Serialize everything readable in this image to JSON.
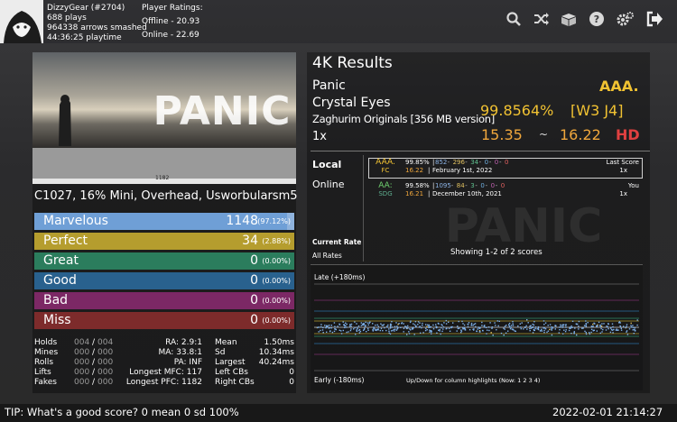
{
  "player": {
    "name": "DizzyGear (#2704)",
    "plays": "688 plays",
    "arrows": "964338 arrows smashed",
    "playtime": "44:36:25 playtime",
    "ratings_title": "Player Ratings:",
    "offline": "Offline - 20.93",
    "online": "Online - 22.69"
  },
  "toolbar": {
    "icons": [
      "search-icon",
      "shuffle-icon",
      "boxes-icon",
      "help-icon",
      "settings-icon",
      "exit-icon"
    ]
  },
  "song": {
    "banner_text": "PANIC",
    "graph_label": "1182",
    "modifiers": "C1027, 16% Mini, Overhead, Usworbularsm5"
  },
  "judgements": [
    {
      "label": "Marvelous",
      "count": "1148",
      "pct": "(97.12%)",
      "color": "#6f9fd6",
      "fill": 0.9712
    },
    {
      "label": "Perfect",
      "count": "34",
      "pct": "(2.88%)",
      "color": "#b59d2e",
      "fill": 0.0288
    },
    {
      "label": "Great",
      "count": "0",
      "pct": "(0.00%)",
      "color": "#2f8f6a",
      "fill": 0
    },
    {
      "label": "Good",
      "count": "0",
      "pct": "(0.00%)",
      "color": "#2d6fa3",
      "fill": 0
    },
    {
      "label": "Bad",
      "count": "0",
      "pct": "(0.00%)",
      "color": "#8e2c73",
      "fill": 0
    },
    {
      "label": "Miss",
      "count": "0",
      "pct": "(0.00%)",
      "color": "#8f2f2f",
      "fill": 0
    }
  ],
  "stats": {
    "col1": [
      {
        "label": "Holds",
        "v1": "004",
        "v2": "004"
      },
      {
        "label": "Mines",
        "v1": "000",
        "v2": "000"
      },
      {
        "label": "Rolls",
        "v1": "000",
        "v2": "000"
      },
      {
        "label": "Lifts",
        "v1": "000",
        "v2": "000"
      },
      {
        "label": "Fakes",
        "v1": "000",
        "v2": "000"
      }
    ],
    "col2": [
      "RA: 2.9:1",
      "MA: 33.8:1",
      "PA: INF",
      "Longest MFC: 117",
      "Longest PFC: 1182"
    ],
    "col3": [
      {
        "label": "Mean",
        "value": "1.50ms"
      },
      {
        "label": "Sd",
        "value": "10.34ms"
      },
      {
        "label": "Largest",
        "value": "40.24ms"
      },
      {
        "label": "Left CBs",
        "value": "0"
      },
      {
        "label": "Right CBs",
        "value": "0"
      }
    ]
  },
  "results": {
    "title": "4K Results",
    "song_title": "Panic",
    "song_subtitle": "Crystal Eyes",
    "pack": "Zaghurim Originals [356 MB version]",
    "rate": "1x",
    "grade": "AAA.",
    "score": "99.8564%",
    "judge": "[W3 J4]",
    "msd": "15.35",
    "tilde": "~",
    "ssr": "16.22",
    "difficulty": "HD"
  },
  "scoreboard": {
    "local_label": "Local",
    "online_label": "Online",
    "current_rate": "Current Rate",
    "all_rates": "All Rates",
    "showing": "Showing 1-2 of 2 scores",
    "scores": [
      {
        "grade": "AAA.",
        "ct": "FC",
        "pct": "99.85%",
        "j": [
          "852",
          "296",
          "34",
          "0",
          "0",
          "0"
        ],
        "ssr": "16.22",
        "date": "February 1st, 2022",
        "tag": "Last Score",
        "rate": "1x"
      },
      {
        "grade": "AA:",
        "ct": "SDG",
        "pct": "99.58%",
        "j": [
          "1095",
          "84",
          "3",
          "0",
          "0",
          "0"
        ],
        "ssr": "16.21",
        "date": "December 10th, 2021",
        "tag": "You",
        "rate": "1x"
      }
    ]
  },
  "offset_plot": {
    "late_label": "Late (+180ms)",
    "early_label": "Early (-180ms)",
    "hint": "Up/Down for column highlights (Now: 1 2 3 4)"
  },
  "footer": {
    "tip": "TIP: What's a good score? 0 mean 0 sd 100%",
    "clock": "2022-02-01 21:14:27"
  }
}
